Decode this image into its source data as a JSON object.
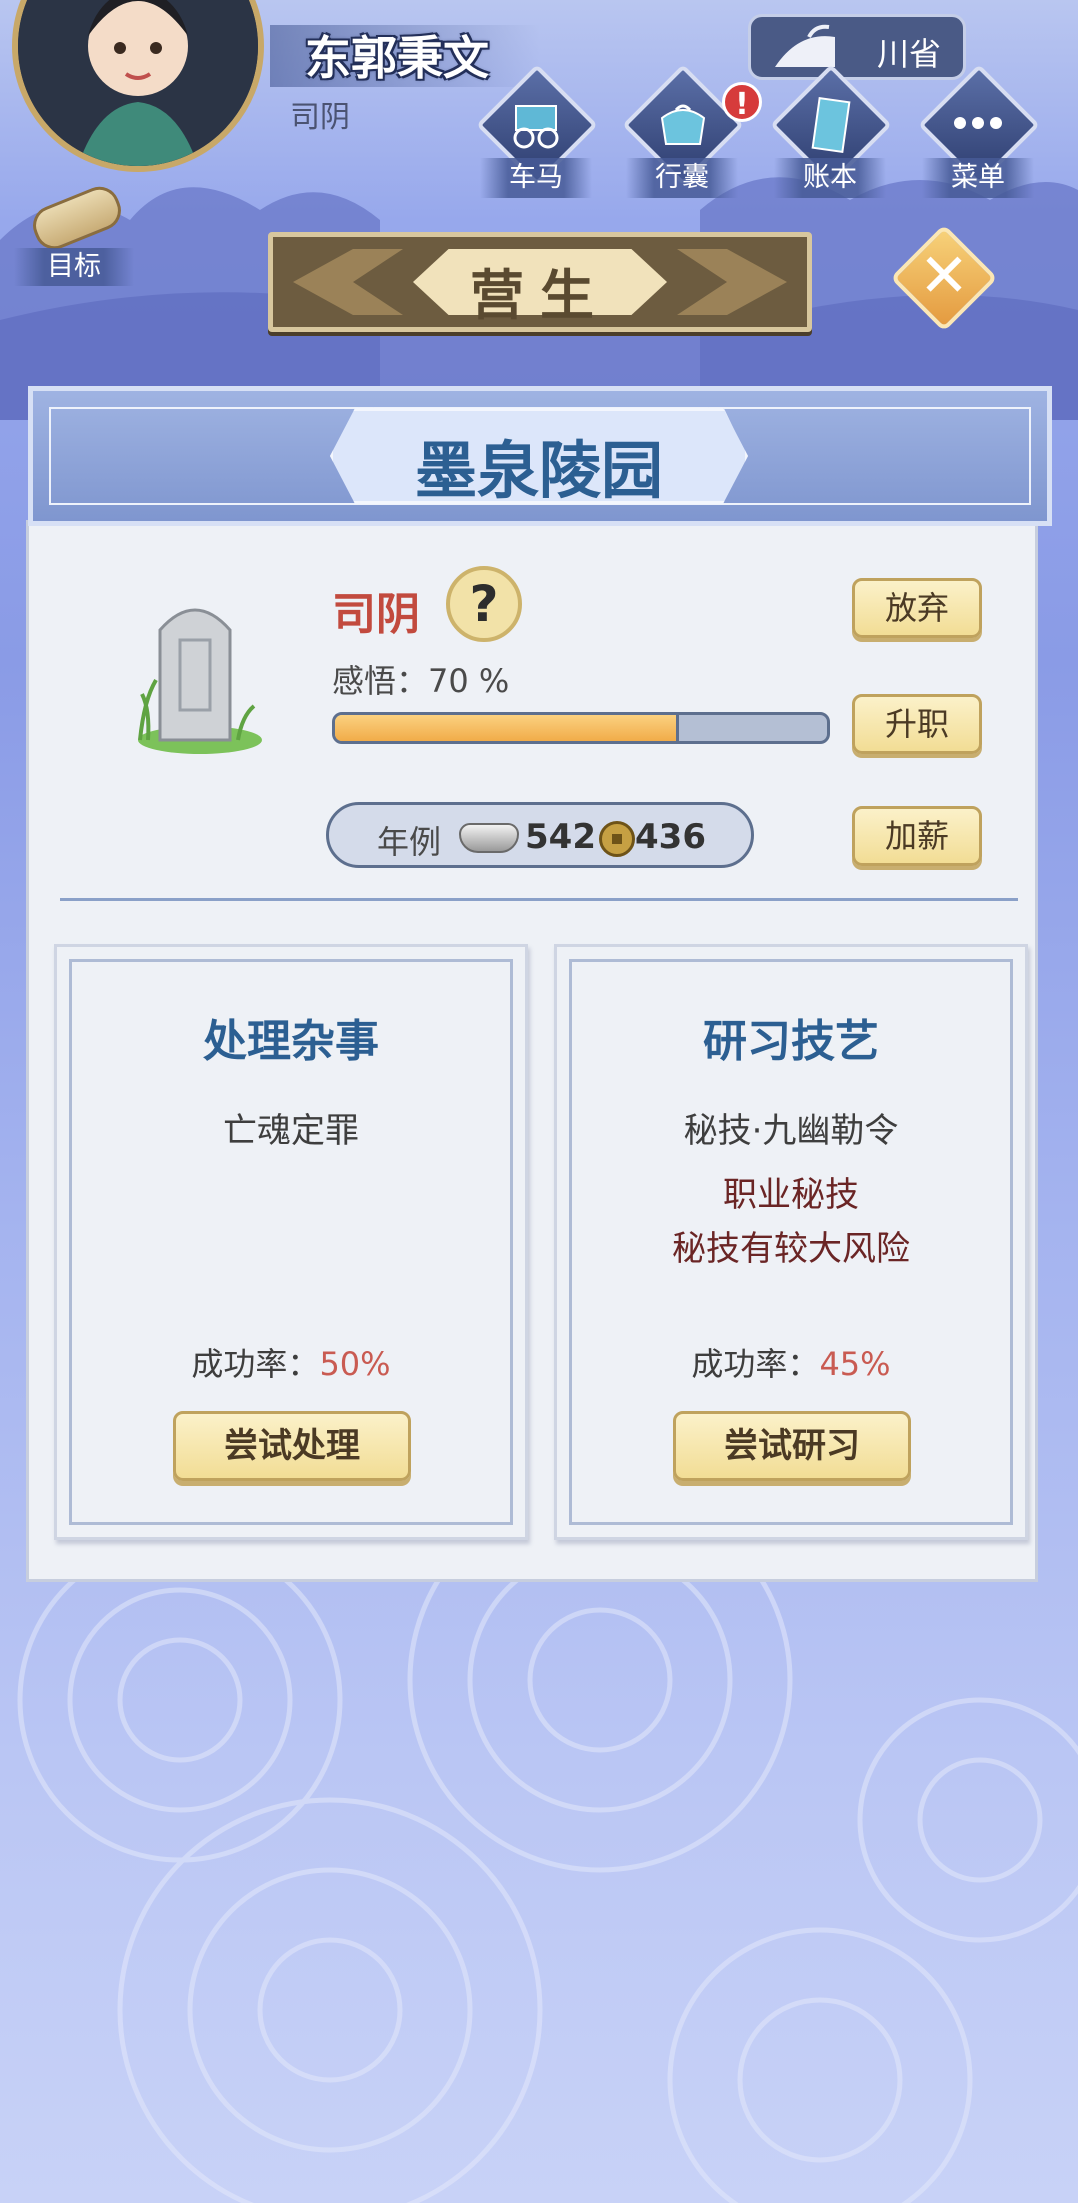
{
  "header": {
    "player_name": "东郭秉文",
    "player_title": "司阴",
    "region": "川省",
    "menu": [
      {
        "label": "车马",
        "icon": "carriage-icon",
        "alert": ""
      },
      {
        "label": "行囊",
        "icon": "bundle-icon",
        "alert": "!"
      },
      {
        "label": "账本",
        "icon": "ledger-icon",
        "alert": ""
      },
      {
        "label": "菜单",
        "icon": "more-icon",
        "alert": ""
      }
    ],
    "goal_label": "目标"
  },
  "section_title": "营生",
  "place": {
    "name": "墨泉陵园",
    "job": "司阴",
    "insight_label": "感悟：70 %",
    "insight_percent": 70,
    "salary_label": "年例",
    "salary_silver": "542",
    "salary_coin": "436",
    "buttons": {
      "abandon": "放弃",
      "promote": "升职",
      "raise": "加薪"
    }
  },
  "tasks": [
    {
      "title": "处理杂事",
      "desc": "亡魂定罪",
      "notes": [],
      "rate_label": "成功率：",
      "rate_value": "50%",
      "button": "尝试处理"
    },
    {
      "title": "研习技艺",
      "desc": "秘技·九幽勒令",
      "notes": [
        "职业秘技",
        "秘技有较大风险"
      ],
      "rate_label": "成功率：",
      "rate_value": "45%",
      "button": "尝试研习"
    }
  ],
  "colors": {
    "accent_blue": "#2c5f92",
    "job_red": "#c24a3e",
    "progress_fill": "#f1ac49",
    "button_gold": "#f2dd95"
  }
}
